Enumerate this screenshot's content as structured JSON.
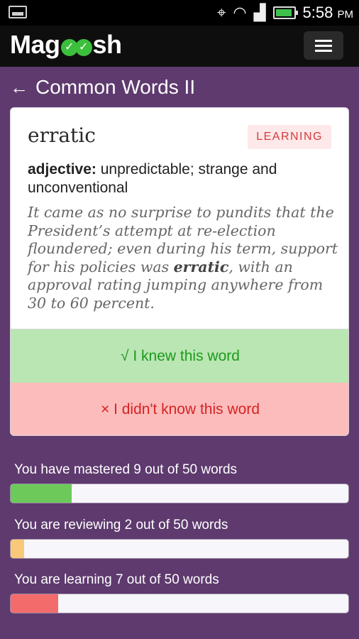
{
  "status_bar": {
    "time": "5:58",
    "ampm": "PM"
  },
  "app_bar": {
    "brand_prefix": "Mag",
    "brand_suffix": "sh"
  },
  "header": {
    "back_arrow": "←",
    "title": "Common Words II"
  },
  "card": {
    "word": "erratic",
    "badge": "LEARNING",
    "part_of_speech": "adjective:",
    "definition": " unpredictable; strange and unconventional",
    "example_before": "It came as no surprise to pundits that the President’s attempt at re-election floundered; even during his term, support for his policies was ",
    "example_word": "erratic",
    "example_after": ", with an approval rating jumping anywhere from 30 to 60 percent.",
    "knew_label": "√ I knew this word",
    "didnt_label": "× I didn't know this word"
  },
  "progress": [
    {
      "label": "You have mastered 9 out of 50 words",
      "count": 9,
      "total": 50,
      "color": "#6cc95a"
    },
    {
      "label": "You are reviewing 2 out of 50 words",
      "count": 2,
      "total": 50,
      "color": "#f9c87a"
    },
    {
      "label": "You are learning 7 out of 50 words",
      "count": 7,
      "total": 50,
      "color": "#f46b6b"
    }
  ]
}
